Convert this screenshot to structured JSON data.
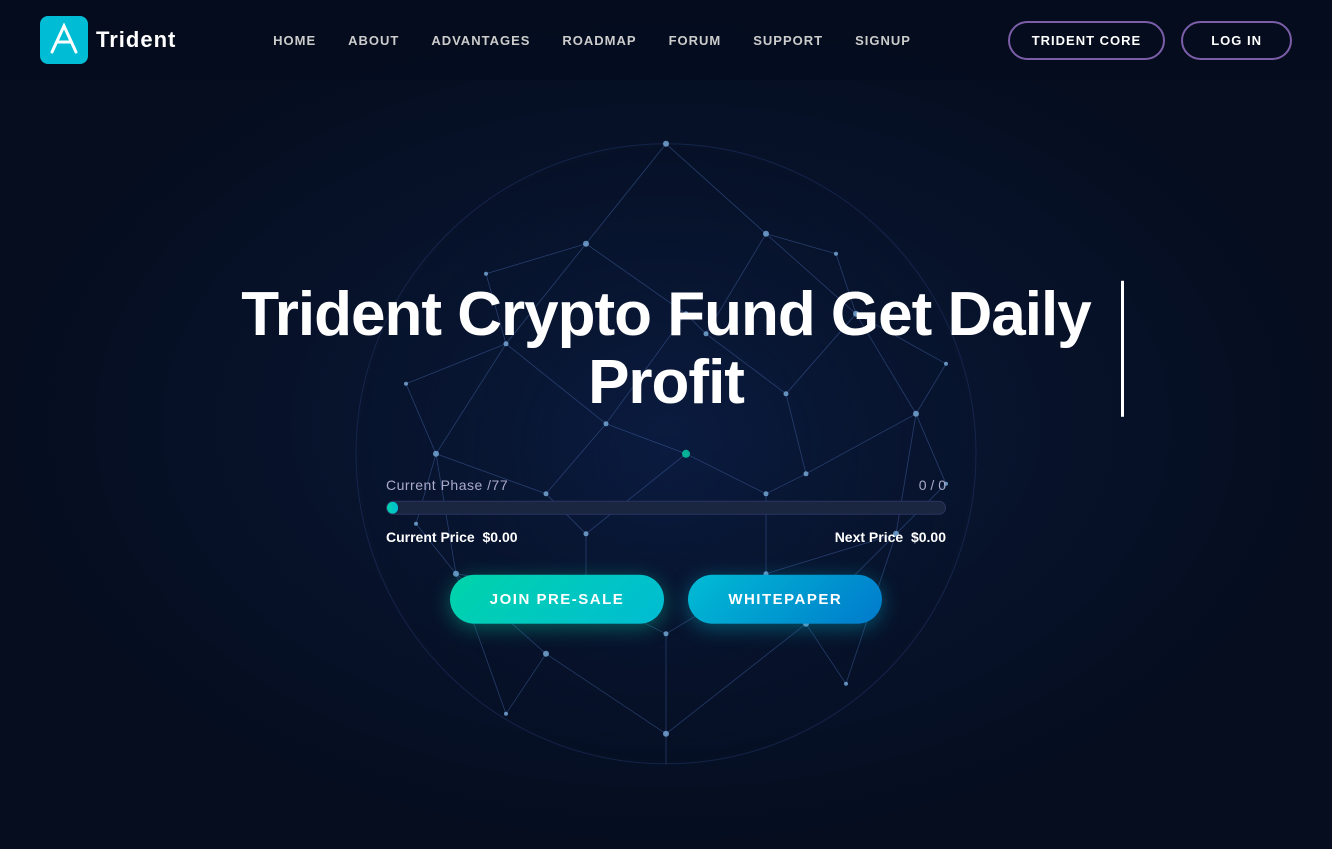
{
  "navbar": {
    "logo_text": "Trident",
    "links": [
      {
        "label": "HOME",
        "id": "home"
      },
      {
        "label": "ABOUT",
        "id": "about"
      },
      {
        "label": "ADVANTAGES",
        "id": "advantages"
      },
      {
        "label": "ROADMAP",
        "id": "roadmap"
      },
      {
        "label": "FORUM",
        "id": "forum"
      },
      {
        "label": "SUPPORT",
        "id": "support"
      },
      {
        "label": "SIGNUP",
        "id": "signup"
      }
    ],
    "trident_core_label": "TRIDENT CORE",
    "login_label": "LOG IN"
  },
  "hero": {
    "title": "Trident Crypto Fund Get Daily Profit",
    "phase_label": "Current Phase /77",
    "phase_count": "0 / 0",
    "progress_percent": 2,
    "current_price_label": "Current Price",
    "current_price_value": "$0.00",
    "next_price_label": "Next Price",
    "next_price_value": "$0.00",
    "join_btn_label": "JOIN PRE-SALE",
    "whitepaper_btn_label": "WHITEPAPER"
  },
  "colors": {
    "accent_teal": "#00d4aa",
    "accent_blue": "#00bcd4",
    "nav_border": "#7b5ea7",
    "bg_dark": "#050d1f"
  }
}
